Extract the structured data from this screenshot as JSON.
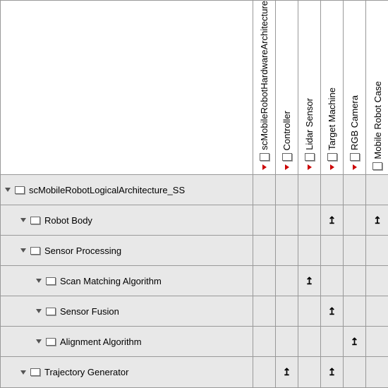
{
  "columns": [
    {
      "label": "scMobileRobotHardwareArchitecture",
      "hasRedArrow": true
    },
    {
      "label": "Controller",
      "hasRedArrow": true
    },
    {
      "label": "Lidar Sensor",
      "hasRedArrow": true
    },
    {
      "label": "Target Machine",
      "hasRedArrow": true
    },
    {
      "label": "RGB Camera",
      "hasRedArrow": true
    },
    {
      "label": "Mobile Robot Case",
      "hasRedArrow": false
    }
  ],
  "rows": [
    {
      "label": "scMobileRobotLogicalArchitecture_SS",
      "indent": 0,
      "cells": [
        "",
        "",
        "",
        "",
        "",
        ""
      ]
    },
    {
      "label": "Robot Body",
      "indent": 1,
      "cells": [
        "",
        "",
        "",
        "↥",
        "",
        "↥"
      ]
    },
    {
      "label": "Sensor Processing",
      "indent": 1,
      "cells": [
        "",
        "",
        "",
        "",
        "",
        ""
      ]
    },
    {
      "label": "Scan Matching Algorithm",
      "indent": 2,
      "cells": [
        "",
        "",
        "↥",
        "",
        "",
        ""
      ]
    },
    {
      "label": "Sensor Fusion",
      "indent": 2,
      "cells": [
        "",
        "",
        "",
        "↥",
        "",
        ""
      ]
    },
    {
      "label": "Alignment Algorithm",
      "indent": 2,
      "cells": [
        "",
        "",
        "",
        "",
        "↥",
        ""
      ]
    },
    {
      "label": "Trajectory Generator",
      "indent": 1,
      "cells": [
        "",
        "↥",
        "",
        "↥",
        "",
        ""
      ]
    }
  ],
  "arrow_glyph": "↥"
}
